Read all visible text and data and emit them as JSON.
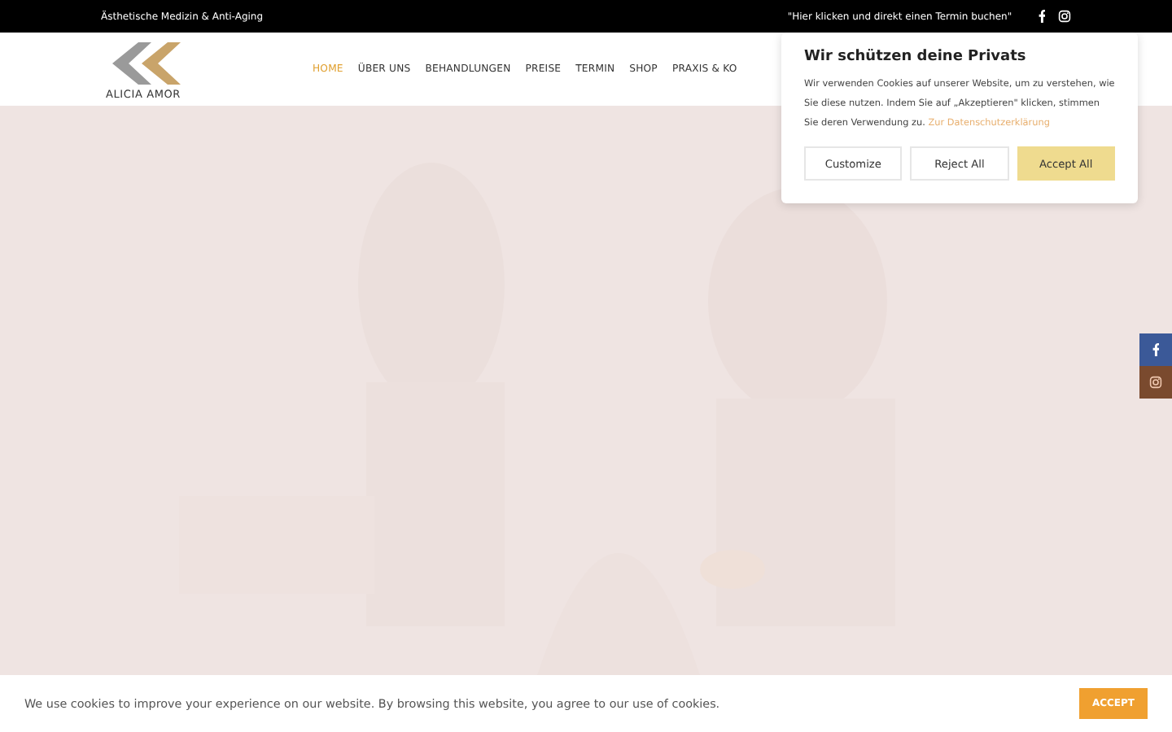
{
  "top_bar": {
    "tagline": "Ästhetische Medizin & Anti-Aging",
    "cta": "\"Hier klicken und direkt einen Termin buchen\""
  },
  "logo": {
    "name": "ALICIA AMOR"
  },
  "nav": [
    {
      "label": "HOME",
      "selected": true
    },
    {
      "label": "ÜBER UNS",
      "selected": false
    },
    {
      "label": "BEHANDLUNGEN",
      "selected": false
    },
    {
      "label": "PREISE",
      "selected": false
    },
    {
      "label": "TERMIN",
      "selected": false
    },
    {
      "label": "SHOP",
      "selected": false
    },
    {
      "label": "PRAXIS & KO",
      "selected": false
    }
  ],
  "privacy_popup": {
    "title": "Wir schützen deine Privats",
    "text": "Wir verwenden Cookies auf unserer Website, um zu verstehen, wie Sie diese nutzen. Indem Sie auf „Akzeptieren\" klicken, stimmen Sie deren Verwendung zu.",
    "link": "Zur Datenschutzerklärung",
    "buttons": [
      {
        "label": "Customize",
        "kind": "outline"
      },
      {
        "label": "Reject All",
        "kind": "outline"
      },
      {
        "label": "Accept All",
        "kind": "primary"
      }
    ]
  },
  "social_sidebar": [
    {
      "kind": "facebook"
    },
    {
      "kind": "instagram"
    }
  ],
  "cookie_bar": {
    "text": "We use cookies to improve your experience on our website. By browsing this website, you agree to our use of cookies.",
    "button": "ACCEPT"
  }
}
